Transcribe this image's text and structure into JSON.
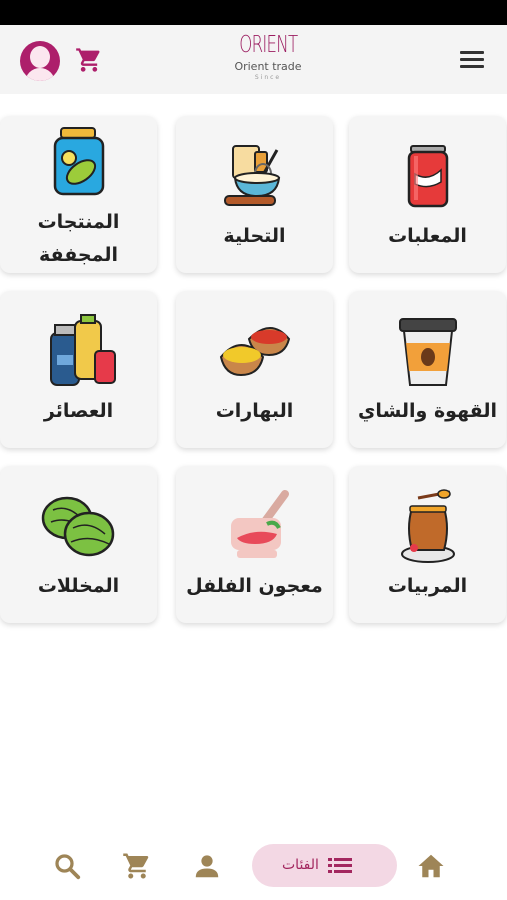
{
  "header": {
    "logo_mark": "ORIENT",
    "logo_name": "Orient trade",
    "logo_sub": "Since"
  },
  "categories": [
    {
      "label": "المعلبات",
      "icon": "canned-drink-icon"
    },
    {
      "label": "التحلية",
      "icon": "baking-whisk-icon"
    },
    {
      "label": "المنتجات المجففة",
      "icon": "pickle-jar-icon"
    },
    {
      "label": "القهوة والشاي",
      "icon": "coffee-cup-icon"
    },
    {
      "label": "البهارات",
      "icon": "spice-bowls-icon"
    },
    {
      "label": "العصائر",
      "icon": "juice-bottles-icon"
    },
    {
      "label": "المربيات",
      "icon": "honey-jar-icon"
    },
    {
      "label": "معجون الفلفل",
      "icon": "mortar-pepper-icon"
    },
    {
      "label": "المخللات",
      "icon": "cabbage-icon"
    }
  ],
  "bottom_nav": {
    "categories_label": "الفئات",
    "items": [
      "search-icon",
      "cart-icon",
      "person-icon",
      "categories-pill",
      "home-icon"
    ]
  },
  "colors": {
    "accent": "#ad1f6b",
    "nav_icon": "#9e8557",
    "pill_bg": "#f3d8e4"
  }
}
